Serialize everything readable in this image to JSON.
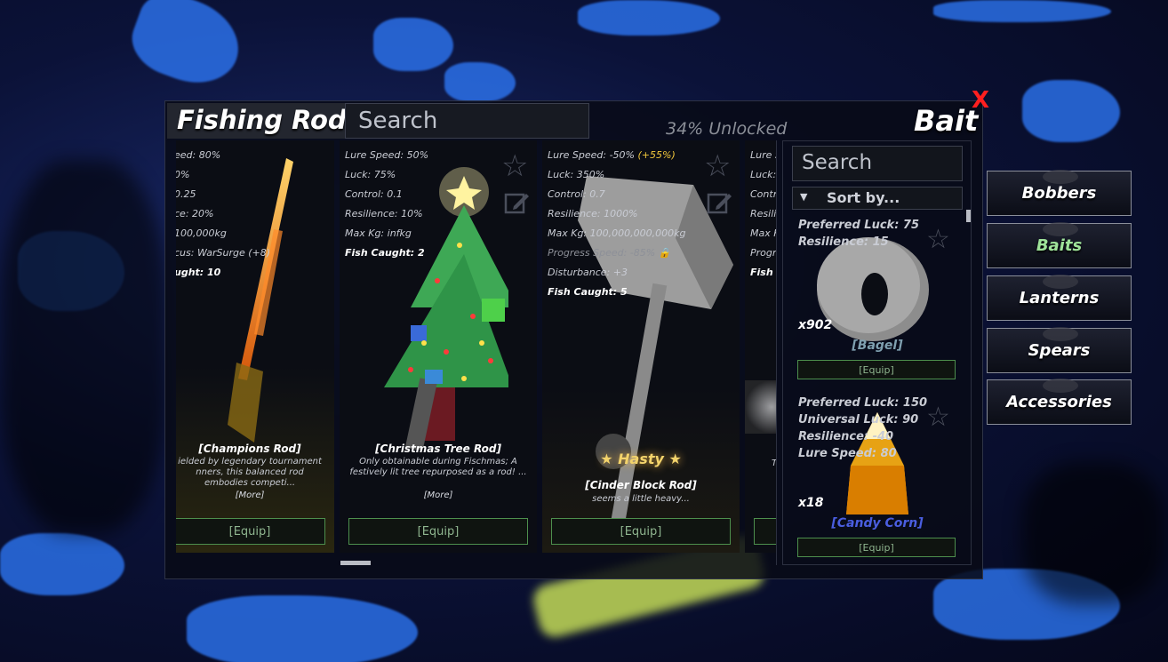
{
  "rods_panel": {
    "title": "Fishing Rods",
    "search_placeholder": "Search",
    "unlocked": "34% Unlocked"
  },
  "bait_panel": {
    "title": "Bait",
    "close": "X",
    "search_placeholder": "Search",
    "sort_label": "Sort by..."
  },
  "rods": [
    {
      "stats": [
        "eed: 80%",
        "0%",
        "0.25",
        "ce: 20%",
        "100,000kg",
        "cus: WarSurge (+8)"
      ],
      "caught": "ught: 10",
      "name": "[Champions Rod]",
      "desc": "ielded by legendary tournament nners, this balanced rod embodies competi...",
      "more": "[More]",
      "equip": "[Equip]"
    },
    {
      "stats": [
        "Lure Speed: 50%",
        "Luck: 75%",
        "Control: 0.1",
        "Resilience: 10%",
        "Max Kg: infkg"
      ],
      "caught": "Fish Caught: 2",
      "name": "[Christmas Tree Rod]",
      "desc": "Only obtainable during Fischmas; A festively lit tree repurposed as a rod! ...",
      "more": "[More]",
      "equip": "[Equip]"
    },
    {
      "stats_first": "Lure Speed: -50%",
      "stats_first_bonus": "(+55%)",
      "stats": [
        "Luck: 350%",
        "Control: 0.7",
        "Resilience: 1000%",
        "Max Kg: 100,000,000,000kg",
        "Progress Speed: -85%",
        "Disturbance: +3"
      ],
      "caught": "Fish Caught: 5",
      "enchant": "★ Hasty ★",
      "name": "[Cinder Block Rod]",
      "desc": "seems a little heavy...",
      "equip": "[Equip]"
    },
    {
      "stats": [
        "Lure S",
        "Luck:",
        "Contr",
        "Resili",
        "Max K",
        "Progr"
      ],
      "caught": "Fish C",
      "desc": "T",
      "equip": ""
    }
  ],
  "baits": [
    {
      "stats": [
        "Preferred Luck: 75",
        "Resilience: 15"
      ],
      "count": "x902",
      "name": "[Bagel]",
      "name_color": "#7fa0b0",
      "equip": "[Equip]"
    },
    {
      "stats": [
        "Preferred Luck: 150",
        "Universal Luck: 90",
        "Resilience: -40",
        "Lure Speed: 80"
      ],
      "count": "x18",
      "name": "[Candy Corn]",
      "name_color": "#4a5ee0",
      "equip": "[Equip]"
    }
  ],
  "categories": [
    {
      "label": "Bobbers",
      "active": false
    },
    {
      "label": "Baits",
      "active": true
    },
    {
      "label": "Lanterns",
      "active": false
    },
    {
      "label": "Spears",
      "active": false
    },
    {
      "label": "Accessories",
      "active": false
    }
  ],
  "colors": {
    "accent_green": "#9fe39a",
    "close_red": "#ff1f1f",
    "bonus_gold": "#f3c83c"
  }
}
